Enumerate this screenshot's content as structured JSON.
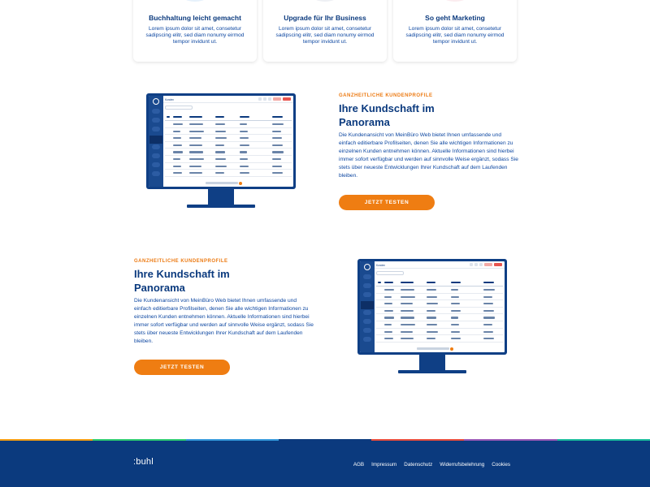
{
  "cards": [
    {
      "title": "Buchhaltung leicht gemacht",
      "text": "Lorem ipsum dolor sit amet, consetetur sadipscing elitr, sed diam nonumy eirmod tempor invidunt ut.",
      "blob_color": "#e6f1fb"
    },
    {
      "title": "Upgrade für Ihr Business",
      "text": "Lorem ipsum dolor sit amet, consetetur sadipscing elitr, sed diam nonumy eirmod tempor invidunt ut.",
      "blob_color": "#eef0f4"
    },
    {
      "title": "So geht Marketing",
      "text": "Lorem ipsum dolor sit amet, consetetur sadipscing elitr, sed diam nonumy eirmod tempor invidunt ut.",
      "blob_color": "#fbecef"
    }
  ],
  "features": [
    {
      "eyebrow": "GANZHEITLICHE KUNDENPROFILE",
      "title": "Ihre Kundschaft im Panorama",
      "text": "Die Kundenansicht von MeinBüro Web bietet Ihnen umfassende und einfach editierbare Profilseiten, denen Sie alle wichtigen Informationen zu einzelnen Kunden entnehmen können. Aktuelle Informationen sind hierbei immer sofort verfügbar und werden auf sinnvolle Weise ergänzt, sodass Sie stets über neueste Entwicklungen Ihrer Kundschaft auf dem Laufenden bleiben.",
      "cta": "JETZT TESTEN"
    },
    {
      "eyebrow": "GANZHEITLICHE KUNDENPROFILE",
      "title": "Ihre Kundschaft im Panorama",
      "text": "Die Kundenansicht von MeinBüro Web bietet Ihnen umfassende und einfach editierbare Profilseiten, denen Sie alle wichtigen Informationen zu einzelnen Kunden entnehmen können. Aktuelle Informationen sind hierbei immer sofort verfügbar und werden auf sinnvolle Weise ergänzt, sodass Sie stets über neueste Entwicklungen Ihrer Kundschaft auf dem Laufenden bleiben.",
      "cta": "JETZT TESTEN"
    }
  ],
  "mockup": {
    "app_title": "Kunden"
  },
  "footer": {
    "brand": ":buhl",
    "links": [
      "AGB",
      "Impressum",
      "Datenschutz",
      "Widerrufsbelehrung",
      "Cookies"
    ],
    "stripe_colors": [
      "#f39c12",
      "#2ecc71",
      "#3498db",
      "#0b3a7e",
      "#e74c3c",
      "#9b59b6",
      "#1abc9c"
    ]
  },
  "colors": {
    "brand_blue": "#0b3a7e",
    "accent_orange": "#ef7d12"
  }
}
